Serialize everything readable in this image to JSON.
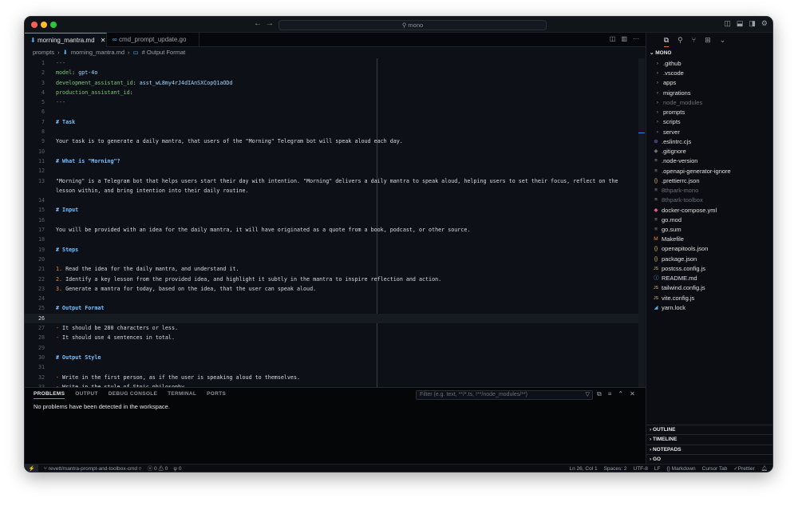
{
  "window": {
    "search_text": "mono"
  },
  "tabs": [
    {
      "label": "morning_mantra.md",
      "icon": "markdown-icon",
      "active": true
    },
    {
      "label": "cmd_prompt_update.go",
      "icon": "go-icon",
      "active": false
    }
  ],
  "breadcrumb": [
    "prompts",
    "morning_mantra.md",
    "# Output Format"
  ],
  "editor": {
    "current_line": 26,
    "lines": [
      [
        [
          "dash",
          "---"
        ]
      ],
      [
        [
          "key",
          "model"
        ],
        [
          "p",
          ": "
        ],
        [
          "val",
          "gpt-4o"
        ]
      ],
      [
        [
          "key",
          "development_assistant_id"
        ],
        [
          "p",
          ": "
        ],
        [
          "val",
          "asst_wL8my4rJ4dIAnSXCopQ1aODd"
        ]
      ],
      [
        [
          "key",
          "production_assistant_id"
        ],
        [
          "p",
          ":"
        ]
      ],
      [
        [
          "dash",
          "---"
        ]
      ],
      [],
      [
        [
          "h",
          "# Task"
        ]
      ],
      [],
      [
        [
          "p",
          "Your task is to generate a daily mantra, that users of the \"Morning\" Telegram bot will speak aloud each day."
        ]
      ],
      [],
      [
        [
          "h",
          "# What is \"Morning\"?"
        ]
      ],
      [],
      [
        [
          "p",
          "\"Morning\" is a Telegram bot that helps users start their day with intention. \"Morning\" delivers a daily mantra to speak aloud, helping users to set their focus, reflect on the lesson within, and bring intention into their daily routine."
        ]
      ],
      [],
      [
        [
          "h",
          "# Input"
        ]
      ],
      [],
      [
        [
          "p",
          "You will be provided with an idea for the daily mantra, it will have originated as a quote from a book, podcast, or other source."
        ]
      ],
      [],
      [
        [
          "h",
          "# Steps"
        ]
      ],
      [],
      [
        [
          "mk",
          "1."
        ],
        [
          "p",
          " Read the idea for the daily mantra, and understand it."
        ]
      ],
      [
        [
          "mk",
          "2."
        ],
        [
          "p",
          " Identify a key lesson from the provided idea, and highlight it subtly in the mantra to inspire reflection and action."
        ]
      ],
      [
        [
          "mk",
          "3."
        ],
        [
          "p",
          " Generate a mantra for today, based on the idea, that the user can speak aloud."
        ]
      ],
      [],
      [
        [
          "h",
          "# Output Format"
        ]
      ],
      [],
      [
        [
          "mk",
          "-"
        ],
        [
          "p",
          " It should be 280 characters or less."
        ]
      ],
      [
        [
          "mk",
          "-"
        ],
        [
          "p",
          " It should use 4 sentences in total."
        ]
      ],
      [],
      [
        [
          "h",
          "# Output Style"
        ]
      ],
      [],
      [
        [
          "mk",
          "-"
        ],
        [
          "p",
          " Write in the first person, as if the user is speaking aloud to themselves."
        ]
      ],
      [
        [
          "mk",
          "-"
        ],
        [
          "p",
          " Write in the style of Stoic philosophy."
        ]
      ]
    ]
  },
  "panel": {
    "tabs": [
      "PROBLEMS",
      "OUTPUT",
      "DEBUG CONSOLE",
      "TERMINAL",
      "PORTS"
    ],
    "active_tab": "PROBLEMS",
    "filter_placeholder": "Filter (e.g. text, **/*.ts, !**/node_modules/**)",
    "message": "No problems have been detected in the workspace."
  },
  "explorer": {
    "root": "MONO",
    "items": [
      {
        "name": ".github",
        "type": "folder"
      },
      {
        "name": ".vscode",
        "type": "folder"
      },
      {
        "name": "apps",
        "type": "folder"
      },
      {
        "name": "migrations",
        "type": "folder"
      },
      {
        "name": "node_modules",
        "type": "folder",
        "dim": true
      },
      {
        "name": "prompts",
        "type": "folder"
      },
      {
        "name": "scripts",
        "type": "folder"
      },
      {
        "name": "server",
        "type": "folder"
      },
      {
        "name": ".eslintrc.cjs",
        "type": "eslint"
      },
      {
        "name": ".gitignore",
        "type": "git"
      },
      {
        "name": ".node-version",
        "type": "file"
      },
      {
        "name": ".openapi-generator-ignore",
        "type": "file"
      },
      {
        "name": ".prettierrc.json",
        "type": "json"
      },
      {
        "name": "8thpark-mono",
        "type": "file",
        "dim": true
      },
      {
        "name": "8thpark-toolbox",
        "type": "file",
        "dim": true
      },
      {
        "name": "docker-compose.yml",
        "type": "docker"
      },
      {
        "name": "go.mod",
        "type": "file"
      },
      {
        "name": "go.sum",
        "type": "file"
      },
      {
        "name": "Makefile",
        "type": "make"
      },
      {
        "name": "openapitools.json",
        "type": "json"
      },
      {
        "name": "package.json",
        "type": "json"
      },
      {
        "name": "postcss.config.js",
        "type": "js"
      },
      {
        "name": "README.md",
        "type": "info"
      },
      {
        "name": "tailwind.config.js",
        "type": "js"
      },
      {
        "name": "vite.config.js",
        "type": "js"
      },
      {
        "name": "yarn.lock",
        "type": "yarn"
      }
    ],
    "sections": [
      "OUTLINE",
      "TIMELINE",
      "NOTEPADS",
      "GO"
    ]
  },
  "status": {
    "branch": "revett/mantra-prompt-and-toolbox-cmd",
    "errors": "0",
    "warnings": "0",
    "ports": "0",
    "position": "Ln 26, Col 1",
    "spaces": "Spaces: 2",
    "encoding": "UTF-8",
    "eol": "LF",
    "language": "Markdown",
    "cursor_tab": "Cursor Tab",
    "prettier": "Prettier"
  },
  "colors": {
    "accent": "#e0664f",
    "heading": "#79c0ff",
    "key": "#7ec77a",
    "list_marker": "#f0883e"
  }
}
